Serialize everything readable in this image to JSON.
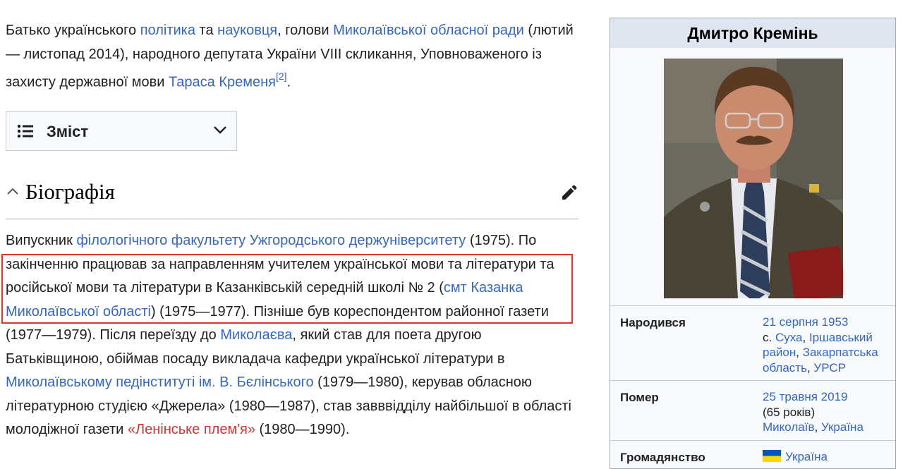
{
  "intro": {
    "t1": "Батько українського ",
    "l_politic": "політика",
    "t2": " та ",
    "l_science": "науковця",
    "t3": ", голови ",
    "l_council": "Миколаївської обласної ради",
    "t4": " (лютий — листопад 2014), народного депутата України VIII скликання, Уповноваженого із захисту державної мови ",
    "l_taras": "Тараса Кременя",
    "ref": "[2]",
    "t5": "."
  },
  "toc": {
    "label": "Зміст"
  },
  "section": {
    "title": "Біографія"
  },
  "bio": {
    "t1": "Випускник ",
    "l_faculty": "філологічного факультету Ужгородського держуніверситету",
    "t2": " (1975). По закінченню працював за направленням учителем української мови та літератури та російської мови та літератури в Казанківській середній школі № 2 (",
    "l_kazanka": "смт Казанка Миколаївської області",
    "t3": ") (1975—1977). Пізніше був кореспондентом районної газети (1977—1979). Після переїзду до ",
    "l_mykolaiv": "Миколаєва",
    "t4": ", який став для поета другою Батьківщиною, обіймав посаду викладача кафедри української літератури в ",
    "l_institute": "Миколаївському педінституті ім. В.  Бєлінського",
    "t5": " (1979—1980), керував обласною літературною студією «Джерела» (1980—1987), став завввідділу найбільшої в області молодіжної газети ",
    "l_newspaper": "«Ленінське плем'я»",
    "t6": " (1980—1990)."
  },
  "infobox": {
    "title": "Дмитро Кремінь",
    "born": {
      "label": "Народився",
      "date": "21 серпня 1953",
      "prefix": "с. ",
      "village": "Суха",
      "sep1": ", ",
      "district": "Іршавський район",
      "sep2": ", ",
      "region": "Закарпатська область",
      "sep3": ", ",
      "country": "УРСР"
    },
    "died": {
      "label": "Помер",
      "date": "25 травня 2019",
      "age": "(65 років)",
      "city": "Миколаїв",
      "sep": ", ",
      "country": "Україна"
    },
    "citizenship": {
      "label": "Громадянство",
      "country": "Україна"
    }
  },
  "colors": {
    "link": "#3366cc",
    "redlink": "#d73333",
    "highlight": "#d9392b",
    "infobox_title": "#dfe6f0"
  },
  "icons": {
    "toc": "list-icon",
    "chevron": "chevron-down-icon",
    "collapse": "chevron-up-icon",
    "edit": "pencil-icon",
    "flag": "ukraine-flag-icon"
  }
}
